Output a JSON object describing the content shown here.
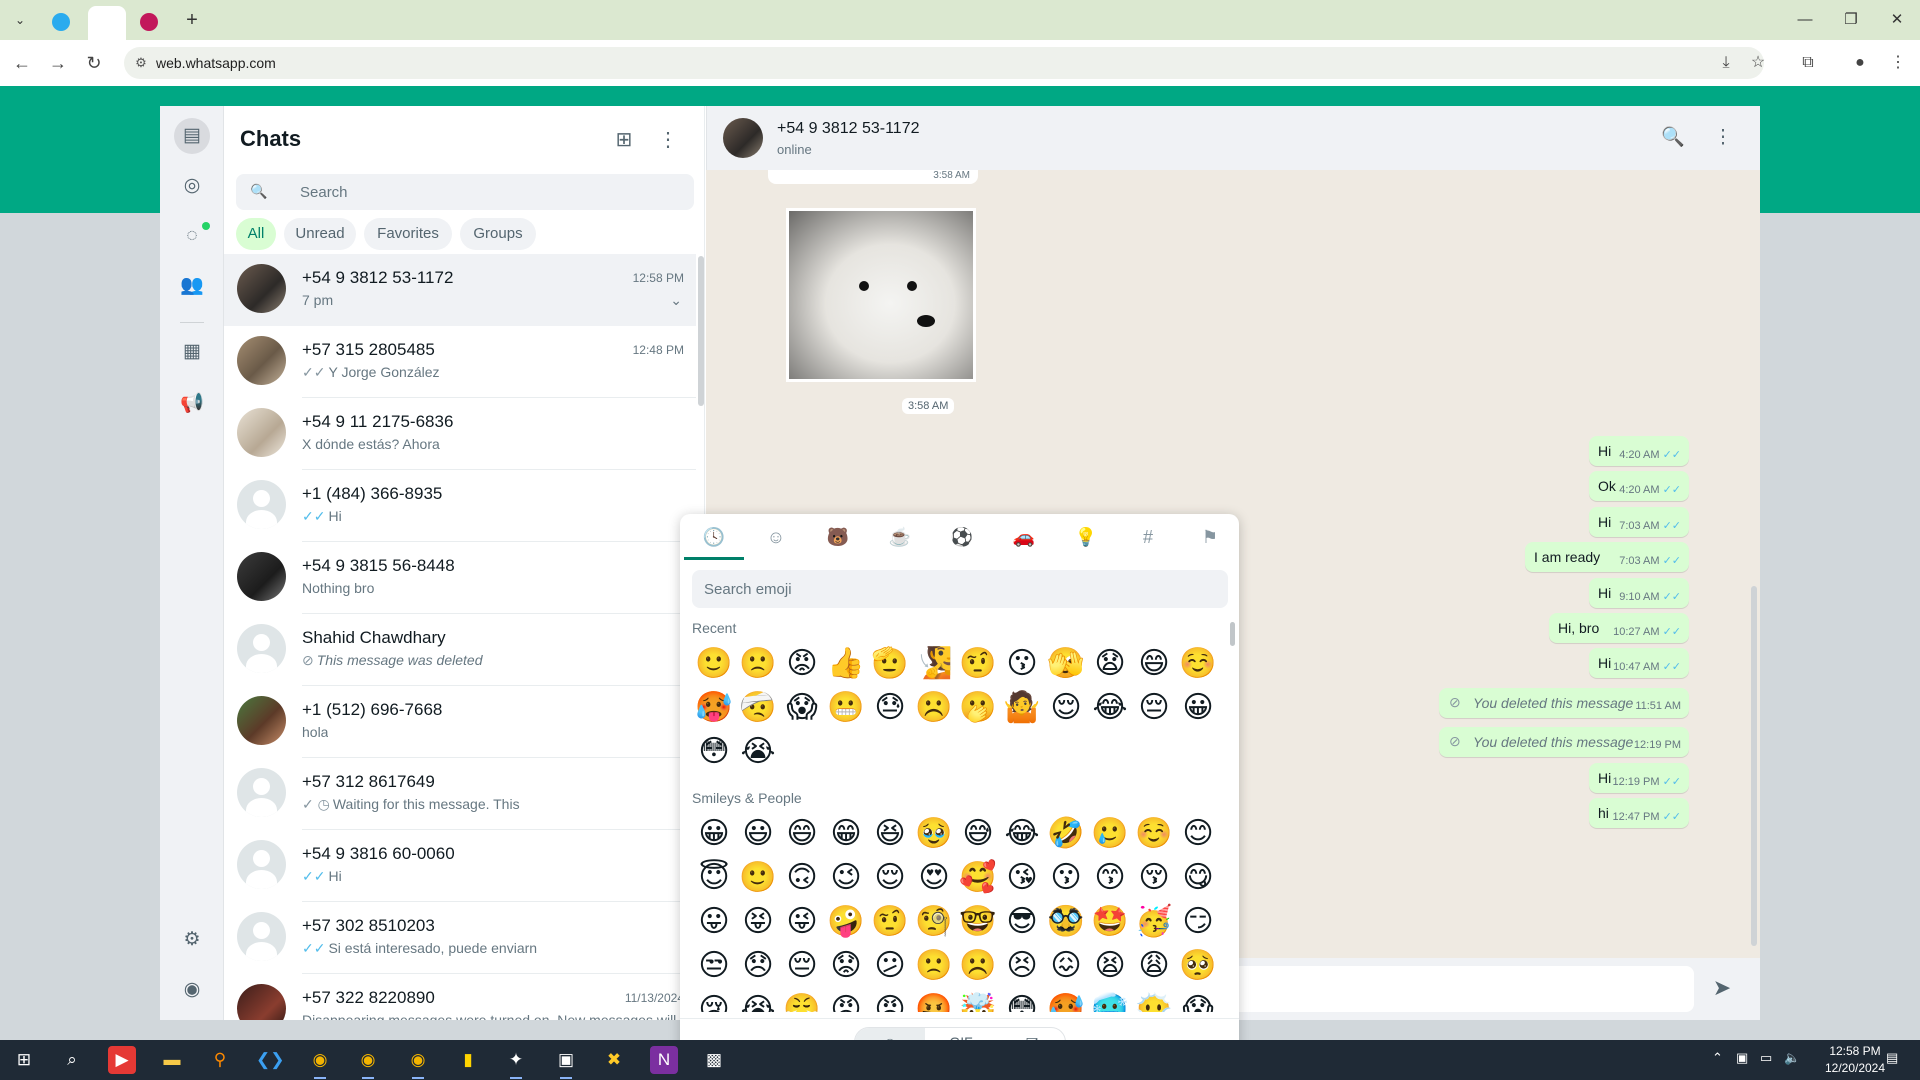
{
  "browser": {
    "url": "web.whatsapp.com",
    "tab_dropdown_icon": "chevron-down",
    "new_tab_label": "+"
  },
  "rail": {
    "items": [
      "chats-icon",
      "status-icon",
      "channels-icon",
      "communities-icon",
      "business-tools-icon",
      "broadcast-icon",
      "settings-icon",
      "profile-icon"
    ]
  },
  "chatlist": {
    "title": "Chats",
    "search_placeholder": "Search",
    "filters": [
      "All",
      "Unread",
      "Favorites",
      "Groups"
    ],
    "active_filter": "All",
    "rows": [
      {
        "name": "+54 9 3812 53-1172",
        "time": "12:58 PM",
        "preview": "7 pm",
        "tick": ""
      },
      {
        "name": "+57 315 2805485",
        "time": "12:48 PM",
        "preview": "Y Jorge González",
        "tick": "✓✓"
      },
      {
        "name": "+54 9 11 2175-6836",
        "time": "",
        "preview": "X dónde estás? Ahora",
        "tick": ""
      },
      {
        "name": "+1 (484) 366-8935",
        "time": "",
        "preview": "Hi",
        "tick": "✓✓"
      },
      {
        "name": "+54 9 3815 56-8448",
        "time": "",
        "preview": "Nothing bro",
        "tick": ""
      },
      {
        "name": "Shahid Chawdhary",
        "time": "",
        "preview": "This message was deleted",
        "tick": "⊘"
      },
      {
        "name": "+1 (512) 696-7668",
        "time": "",
        "preview": "hola",
        "tick": ""
      },
      {
        "name": "+57 312 8617649",
        "time": "",
        "preview": "Waiting for this message. This",
        "tick": "✓ ◷"
      },
      {
        "name": "+54 9 3816 60-0060",
        "time": "",
        "preview": "Hi",
        "tick": "✓✓"
      },
      {
        "name": "+57 302 8510203",
        "time": "",
        "preview": "Si está interesado, puede enviarn",
        "tick": "✓✓"
      },
      {
        "name": "+57 322 8220890",
        "time": "11/13/2024",
        "preview": "Disappearing messages were turned on. New messages will",
        "tick": ""
      }
    ]
  },
  "conversation": {
    "contact_name": "+54 9 3812 53-1172",
    "status": "online",
    "prev_time": "3:58 AM",
    "image_time": "3:58 AM",
    "messages": [
      {
        "text": "Hi",
        "time": "4:20 AM",
        "deleted": false
      },
      {
        "text": "Ok",
        "time": "4:20 AM",
        "deleted": false
      },
      {
        "text": "Hi",
        "time": "7:03 AM",
        "deleted": false
      },
      {
        "text": "I am ready",
        "time": "7:03 AM",
        "deleted": false
      },
      {
        "text": "Hi",
        "time": "9:10 AM",
        "deleted": false
      },
      {
        "text": "Hi, bro",
        "time": "10:27 AM",
        "deleted": false
      },
      {
        "text": "Hi",
        "time": "10:47 AM",
        "deleted": false
      },
      {
        "text": "You deleted this message",
        "time": "11:51 AM",
        "deleted": true
      },
      {
        "text": "You deleted this message",
        "time": "12:19 PM",
        "deleted": true
      },
      {
        "text": "Hi",
        "time": "12:19 PM",
        "deleted": false
      },
      {
        "text": "hi",
        "time": "12:47 PM",
        "deleted": false
      }
    ],
    "read_tick": "✓✓"
  },
  "emoji_panel": {
    "search_placeholder": "Search emoji",
    "recent_label": "Recent",
    "smileys_label": "Smileys & People",
    "recent": [
      "🙂",
      "🙁",
      "😡",
      "👍",
      "🫡",
      "🧏",
      "🤨",
      "😗",
      "🫣",
      "😧",
      "😄",
      "☺️",
      "🥵",
      "🤕",
      "😱",
      "😬",
      "😓",
      "☹️",
      "🫢",
      "🤷",
      "😌",
      "😂",
      "😔",
      "😀",
      "😳",
      "😭"
    ],
    "smileys": [
      "😀",
      "😃",
      "😄",
      "😁",
      "😆",
      "🥹",
      "😅",
      "😂",
      "🤣",
      "🥲",
      "☺️",
      "😊",
      "😇",
      "🙂",
      "🙃",
      "😉",
      "😌",
      "😍",
      "🥰",
      "😘",
      "😗",
      "😙",
      "😚",
      "😋",
      "😛",
      "😝",
      "😜",
      "🤪",
      "🤨",
      "🧐",
      "🤓",
      "😎",
      "🥸",
      "🤩",
      "🥳",
      "😏",
      "😒",
      "😞",
      "😔",
      "😟",
      "😕",
      "🙁",
      "☹️",
      "😣",
      "😖",
      "😫",
      "😩",
      "🥺",
      "😢",
      "😭",
      "😤",
      "😠",
      "😡",
      "🤬",
      "🤯",
      "😳",
      "🥵",
      "🥶",
      "😶‍🌫️",
      "😱"
    ],
    "segments": [
      "emoji-tab",
      "GIF",
      "sticker-tab"
    ]
  },
  "taskbar": {
    "time": "12:58 PM",
    "date": "12/20/2024"
  }
}
